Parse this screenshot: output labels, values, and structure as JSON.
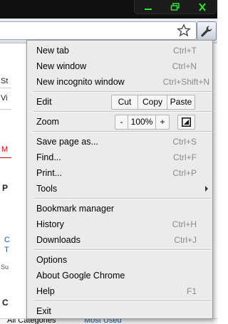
{
  "menu": {
    "items": [
      {
        "label": "New tab",
        "accel": "Ctrl+T"
      },
      {
        "label": "New window",
        "accel": "Ctrl+N"
      },
      {
        "label": "New incognito window",
        "accel": "Ctrl+Shift+N"
      }
    ],
    "edit": {
      "label": "Edit",
      "cut": "Cut",
      "copy": "Copy",
      "paste": "Paste"
    },
    "zoom": {
      "label": "Zoom",
      "minus": "-",
      "level": "100%",
      "plus": "+"
    },
    "page_items": [
      {
        "label": "Save page as...",
        "accel": "Ctrl+S"
      },
      {
        "label": "Find...",
        "accel": "Ctrl+F"
      },
      {
        "label": "Print...",
        "accel": "Ctrl+P"
      },
      {
        "label": "Tools",
        "accel": ""
      }
    ],
    "nav_items": [
      {
        "label": "Bookmark manager",
        "accel": ""
      },
      {
        "label": "History",
        "accel": "Ctrl+H"
      },
      {
        "label": "Downloads",
        "accel": "Ctrl+J"
      }
    ],
    "help_items": [
      {
        "label": "Options",
        "accel": ""
      },
      {
        "label": "About Google Chrome",
        "accel": ""
      },
      {
        "label": "Help",
        "accel": "F1"
      }
    ],
    "exit": {
      "label": "Exit"
    }
  },
  "background": {
    "fragments": [
      "St",
      "Vi",
      "M",
      "P",
      "C",
      "T",
      "Su",
      "C"
    ],
    "bottom_tab_1": "All Categories",
    "bottom_tab_2": "Most Used"
  },
  "colors": {
    "window_button_green": "#2fe43a",
    "menu_bg": "#ebebeb",
    "accel_text": "#8a8a8a"
  },
  "icons": {
    "minimize": "minimize-icon",
    "maximize": "maximize-icon",
    "close": "close-icon",
    "bookmark": "star-icon",
    "menu": "wrench-icon",
    "fullscreen": "fullscreen-icon",
    "submenu": "arrow-right-icon"
  }
}
